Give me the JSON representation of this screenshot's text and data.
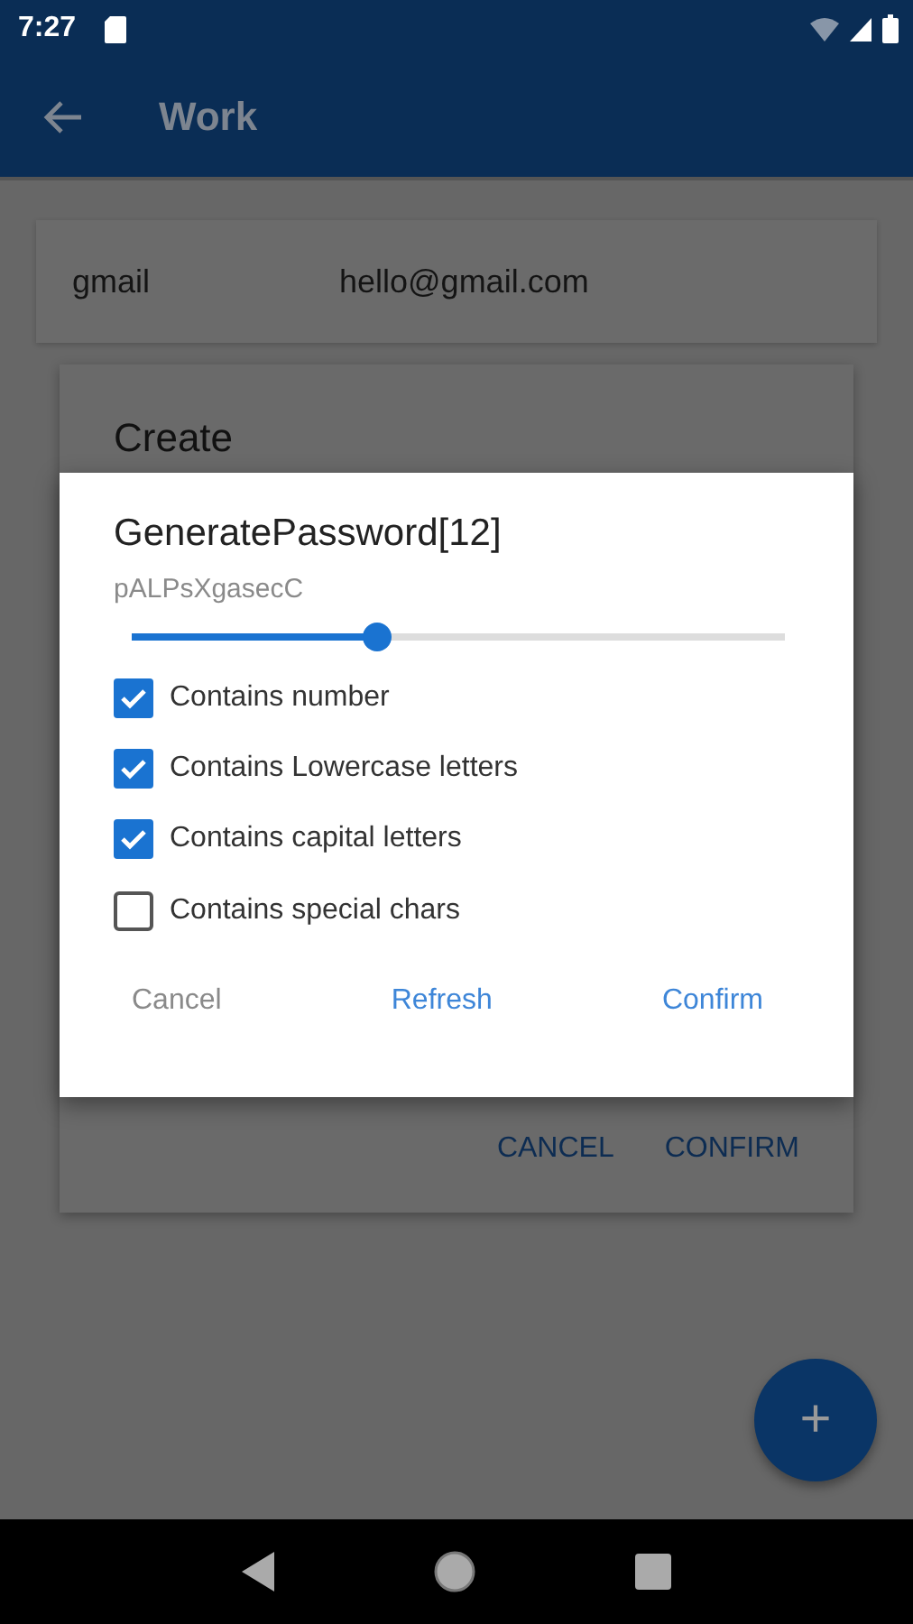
{
  "status_bar": {
    "time": "7:27"
  },
  "app_bar": {
    "title": "Work"
  },
  "entries": [
    {
      "name": "gmail",
      "account": "hello@gmail.com"
    }
  ],
  "create_dialog": {
    "title": "Create",
    "buttons": [
      "CANCEL",
      "CONFIRM"
    ]
  },
  "password_dialog": {
    "title": "GeneratePassword[12]",
    "password": "pALPsXgasecC",
    "length_slider": {
      "level": 0.376
    },
    "options": [
      {
        "label": "Contains number",
        "checked": true
      },
      {
        "label": "Contains Lowercase letters",
        "checked": true
      },
      {
        "label": "Contains capital letters",
        "checked": true
      },
      {
        "label": "Contains special chars",
        "checked": false
      }
    ],
    "buttons": [
      {
        "label": "Cancel",
        "kind": "neutral"
      },
      {
        "label": "Refresh",
        "kind": "accent"
      },
      {
        "label": "Confirm",
        "kind": "accent"
      }
    ]
  },
  "fab": {
    "label": "+"
  }
}
